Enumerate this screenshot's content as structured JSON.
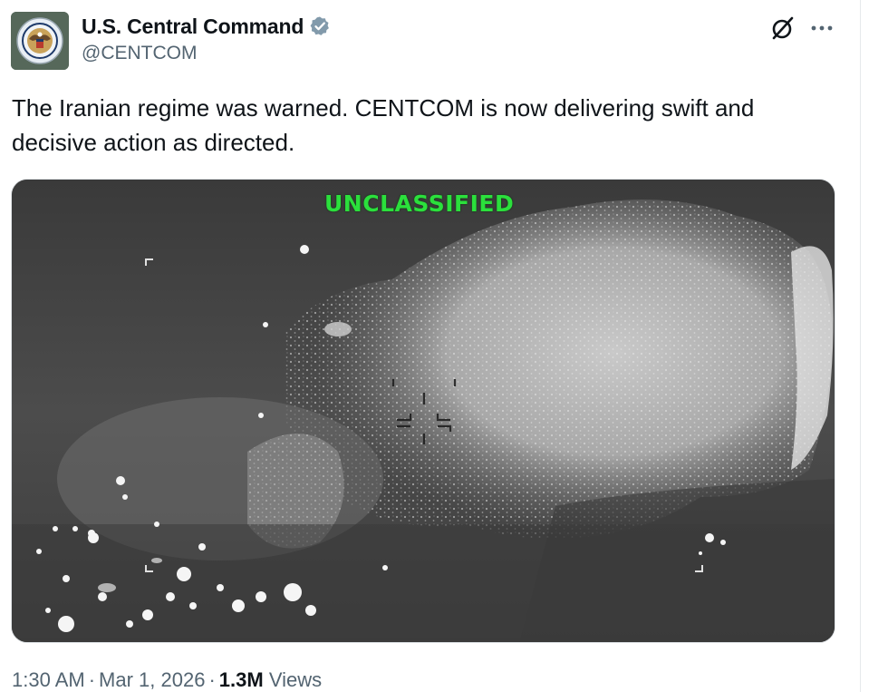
{
  "author": {
    "display_name": "U.S. Central Command",
    "handle": "@CENTCOM",
    "verified_color": "#829aab"
  },
  "actions": {
    "grok_icon": "grok-icon",
    "more_icon": "more-horizontal-icon"
  },
  "tweet": {
    "text": "The Iranian regime was warned. CENTCOM is now delivering swift and decisive action as directed."
  },
  "media": {
    "overlay_label": "UNCLASSIFIED",
    "overlay_color": "#2be03c"
  },
  "meta": {
    "time": "1:30 AM",
    "separator": "·",
    "date": "Mar 1, 2026",
    "views_count": "1.3M",
    "views_label": "Views"
  }
}
